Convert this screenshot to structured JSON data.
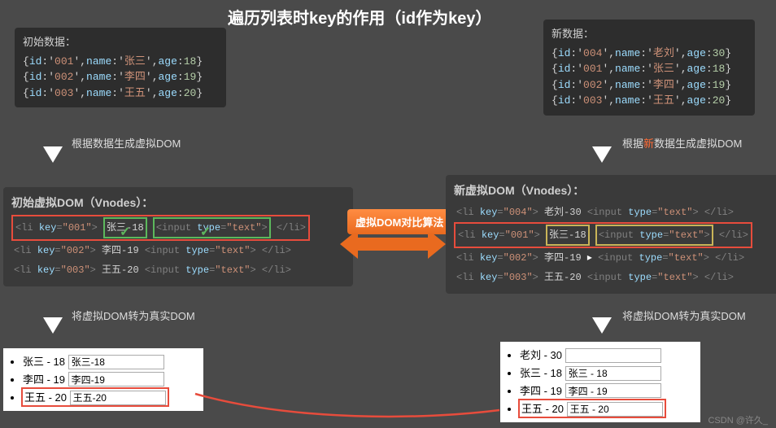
{
  "title": "遍历列表时key的作用（id作为key）",
  "initial_data": {
    "header": "初始数据：",
    "rows": [
      {
        "id": "001",
        "name": "张三",
        "age": 18
      },
      {
        "id": "002",
        "name": "李四",
        "age": 19
      },
      {
        "id": "003",
        "name": "王五",
        "age": 20
      }
    ]
  },
  "new_data": {
    "header": "新数据：",
    "rows": [
      {
        "id": "004",
        "name": "老刘",
        "age": 30
      },
      {
        "id": "001",
        "name": "张三",
        "age": 18
      },
      {
        "id": "002",
        "name": "李四",
        "age": 19
      },
      {
        "id": "003",
        "name": "王五",
        "age": 20
      }
    ]
  },
  "captions": {
    "gen_left": "根据数据生成虚拟DOM",
    "gen_right_pre": "根据",
    "gen_right_mid": "新",
    "gen_right_post": "数据生成虚拟DOM",
    "to_real_left": "将虚拟DOM转为真实DOM",
    "to_real_right": "将虚拟DOM转为真实DOM"
  },
  "vdom_left": {
    "header": "初始虚拟DOM（Vnodes）：",
    "rows": [
      {
        "key": "001",
        "text": "张三-18",
        "input": "<input type=\"text\">",
        "hl": "green"
      },
      {
        "key": "002",
        "text": "李四-19",
        "input": "<input type=\"text\">",
        "hl": "none"
      },
      {
        "key": "003",
        "text": "王五-20",
        "input": "<input type=\"text\">",
        "hl": "none"
      }
    ]
  },
  "vdom_right": {
    "header": "新虚拟DOM（Vnodes）：",
    "rows": [
      {
        "key": "004",
        "text": "老刘-30",
        "input": "<input type=\"text\">",
        "hl": "none"
      },
      {
        "key": "001",
        "text": "张三-18",
        "input": "<input type=\"text\">",
        "hl": "yellow_red"
      },
      {
        "key": "002",
        "text": "李四-19",
        "input": "<input type=\"text\">",
        "hl": "none"
      },
      {
        "key": "003",
        "text": "王五-20",
        "input": "<input type=\"text\">",
        "hl": "none"
      }
    ]
  },
  "compare_label": "虚拟DOM对比算法",
  "real_left": {
    "items": [
      {
        "label": "张三 - 18",
        "value": "张三-18"
      },
      {
        "label": "李四 - 19",
        "value": "李四-19"
      },
      {
        "label": "王五 - 20",
        "value": "王五-20",
        "hl": true
      }
    ]
  },
  "real_right": {
    "items": [
      {
        "label": "老刘 - 30",
        "value": ""
      },
      {
        "label": "张三 - 18",
        "value": "张三 - 18"
      },
      {
        "label": "李四 - 19",
        "value": "李四 - 19"
      },
      {
        "label": "王五 - 20",
        "value": "王五 - 20",
        "hl": true
      }
    ]
  },
  "watermark": "CSDN @许久_"
}
